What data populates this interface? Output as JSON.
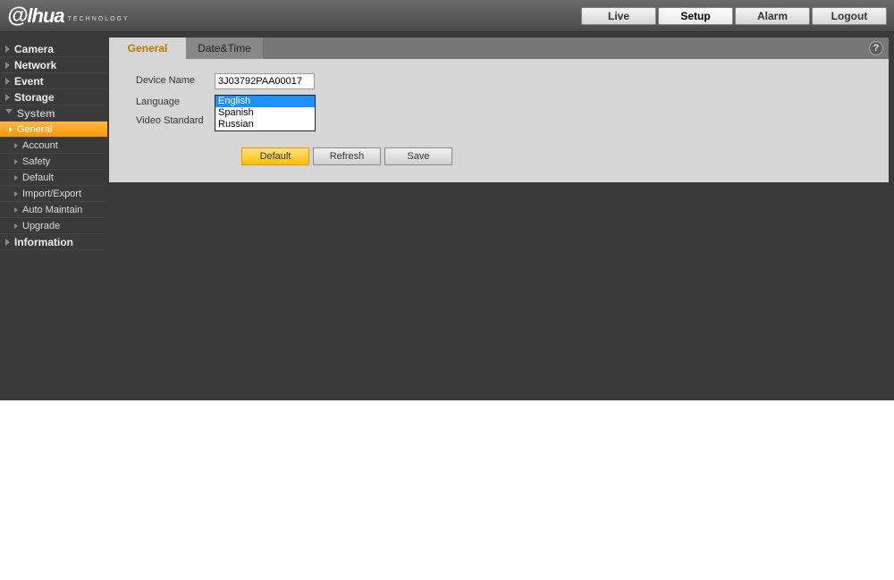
{
  "brand": {
    "name_html": "alhua",
    "sub": "TECHNOLOGY"
  },
  "nav": {
    "live": "Live",
    "setup": "Setup",
    "alarm": "Alarm",
    "logout": "Logout"
  },
  "sidebar": {
    "camera": "Camera",
    "network": "Network",
    "event": "Event",
    "storage": "Storage",
    "system": "System",
    "system_children": {
      "general": "General",
      "account": "Account",
      "safety": "Safety",
      "default": "Default",
      "import_export": "Import/Export",
      "auto_maintain": "Auto Maintain",
      "upgrade": "Upgrade"
    },
    "information": "Information"
  },
  "content": {
    "tabs": {
      "general": "General",
      "datetime": "Date&Time"
    },
    "help_symbol": "?",
    "labels": {
      "device_name": "Device Name",
      "language": "Language",
      "video_standard": "Video Standard"
    },
    "values": {
      "device_name": "3J03792PAA00017"
    },
    "language_options": {
      "english": "English",
      "spanish": "Spanish",
      "russian": "Russian"
    },
    "buttons": {
      "default": "Default",
      "refresh": "Refresh",
      "save": "Save"
    }
  }
}
